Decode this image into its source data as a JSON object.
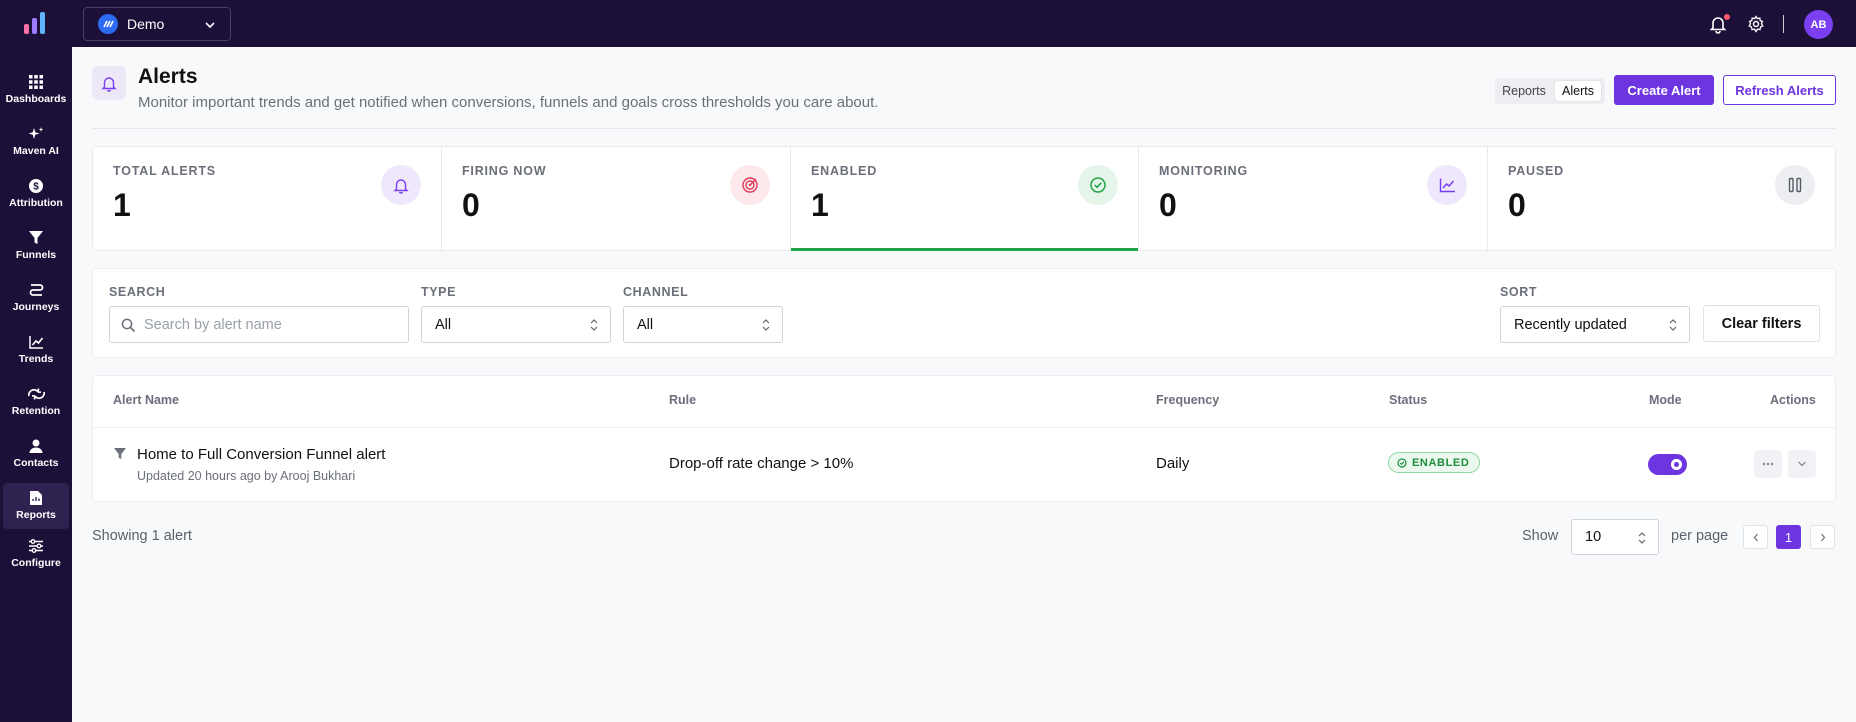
{
  "topbar": {
    "workspace_name": "Demo",
    "avatar_initials": "AB",
    "colors": {
      "bg": "#1c0f38",
      "accent": "#6d35e0"
    }
  },
  "sidebar": {
    "items": [
      {
        "label": "Dashboards",
        "icon": "grid-icon"
      },
      {
        "label": "Maven AI",
        "icon": "sparkle-icon"
      },
      {
        "label": "Attribution",
        "icon": "dollar-icon"
      },
      {
        "label": "Funnels",
        "icon": "funnel-icon"
      },
      {
        "label": "Journeys",
        "icon": "route-icon"
      },
      {
        "label": "Trends",
        "icon": "trend-icon"
      },
      {
        "label": "Retention",
        "icon": "retention-icon"
      },
      {
        "label": "Contacts",
        "icon": "user-icon"
      },
      {
        "label": "Reports",
        "icon": "report-icon",
        "active": true
      },
      {
        "label": "Configure",
        "icon": "sliders-icon"
      }
    ]
  },
  "header": {
    "title": "Alerts",
    "subtitle": "Monitor important trends and get notified when conversions, funnels and goals cross thresholds you care about.",
    "segment": {
      "reports": "Reports",
      "alerts": "Alerts",
      "selected": "Alerts"
    },
    "create_label": "Create Alert",
    "refresh_label": "Refresh Alerts"
  },
  "stats": [
    {
      "label": "TOTAL ALERTS",
      "value": "1",
      "icon": "bell-icon",
      "color": "#7a3ff0"
    },
    {
      "label": "FIRING NOW",
      "value": "0",
      "icon": "target-icon",
      "color": "#e03a5a"
    },
    {
      "label": "ENABLED",
      "value": "1",
      "icon": "check-circle-icon",
      "color": "#22a548",
      "selected": true
    },
    {
      "label": "MONITORING",
      "value": "0",
      "icon": "trend-icon",
      "color": "#7a3ff0"
    },
    {
      "label": "PAUSED",
      "value": "0",
      "icon": "pause-icon",
      "color": "#555a63"
    }
  ],
  "filters": {
    "search_label": "SEARCH",
    "search_placeholder": "Search by alert name",
    "type_label": "TYPE",
    "type_value": "All",
    "channel_label": "CHANNEL",
    "channel_value": "All",
    "sort_label": "SORT",
    "sort_value": "Recently updated",
    "clear_label": "Clear filters"
  },
  "table": {
    "columns": [
      "Alert Name",
      "Rule",
      "Frequency",
      "Status",
      "Mode",
      "Actions"
    ],
    "rows": [
      {
        "name": "Home to Full Conversion Funnel alert",
        "meta": "Updated 20 hours ago by Arooj Bukhari",
        "rule": "Drop-off rate change > 10%",
        "frequency": "Daily",
        "status": "ENABLED",
        "mode_on": true
      }
    ]
  },
  "footer": {
    "showing": "Showing 1 alert",
    "show_label": "Show",
    "per_page_value": "10",
    "per_page_label": "per page",
    "current_page": "1"
  }
}
